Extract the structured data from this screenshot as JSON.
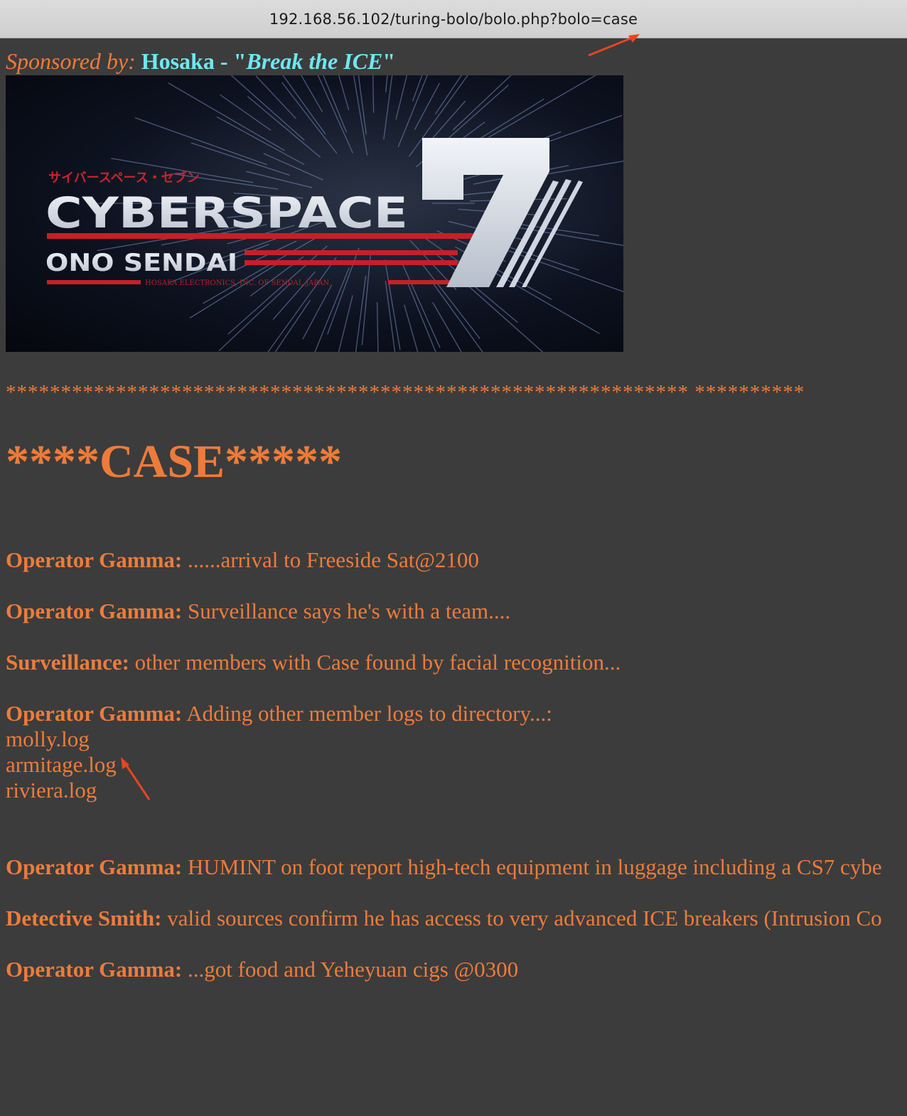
{
  "browser": {
    "url": "192.168.56.102/turing-bolo/bolo.php?bolo=case"
  },
  "sponsor": {
    "label": "Sponsored by:",
    "brand": "Hosaka -",
    "quote_open": "\"",
    "slogan": "Break the ICE",
    "quote_close": "\""
  },
  "banner": {
    "katakana": "サイバースペース・セブン",
    "title": "CYBERSPACE",
    "number": "7",
    "subtitle": "ONO SENDAI",
    "maker": "HOSAKA ELECTRONICS, INC. OF SENDAI, JAPAN"
  },
  "separator": "************************************************************** **********",
  "heading": "****CASE*****",
  "log": [
    {
      "speaker": "Operator Gamma:",
      "text": "......arrival to Freeside Sat@2100"
    },
    {
      "speaker": "Operator Gamma:",
      "text": "Surveillance says he's with a team...."
    },
    {
      "speaker": "Surveillance:",
      "text": "other members with Case found by facial recognition..."
    },
    {
      "speaker": "Operator Gamma:",
      "text": "Adding other member logs to directory...:"
    }
  ],
  "files": [
    "molly.log",
    "armitage.log",
    "riviera.log"
  ],
  "log2": [
    {
      "speaker": "Operator Gamma:",
      "text": "HUMINT on foot report high-tech equipment in luggage including a CS7 cybe"
    },
    {
      "speaker": "Detective Smith:",
      "text": "valid sources confirm he has access to very advanced ICE breakers (Intrusion Co"
    },
    {
      "speaker": "Operator Gamma:",
      "text": "...got food and Yeheyuan cigs @0300"
    }
  ],
  "colors": {
    "background": "#3c3c3c",
    "text": "#ee7b3a",
    "sponsor_accent": "#6fe7f0",
    "annotation_arrow": "#e8451f"
  }
}
